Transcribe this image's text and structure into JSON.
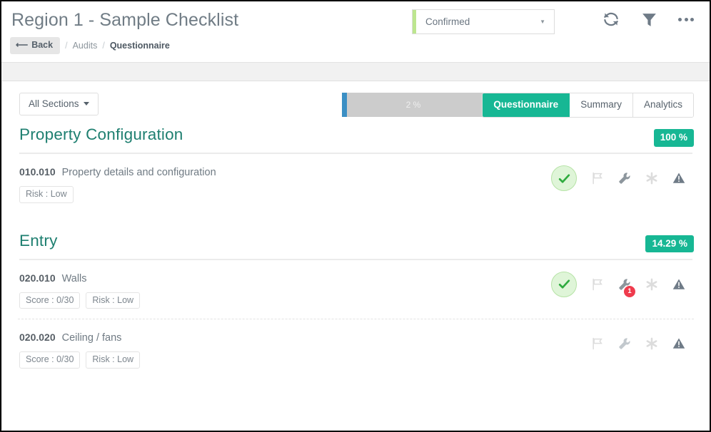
{
  "header": {
    "title": "Region 1 - Sample Checklist",
    "back_label": "Back",
    "back_icon": "arrow-left-icon",
    "breadcrumb": {
      "separator": "/",
      "parent": "Audits",
      "current": "Questionnaire"
    },
    "status": {
      "value": "Confirmed",
      "caret": "▼",
      "accent_color": "#bde68f"
    },
    "icons": [
      {
        "name": "refresh-icon"
      },
      {
        "name": "filter-icon"
      },
      {
        "name": "more-options-icon"
      }
    ]
  },
  "toolbar": {
    "sections_filter_label": "All Sections",
    "progress": {
      "percent_label": "2 %",
      "percent_value": 2,
      "fill_color": "#3b8fc4",
      "track_color": "#cccccc"
    },
    "tabs": [
      {
        "label": "Questionnaire",
        "active": true
      },
      {
        "label": "Summary",
        "active": false
      },
      {
        "label": "Analytics",
        "active": false
      }
    ]
  },
  "colors": {
    "accent_teal": "#17b794",
    "section_title": "#1e7f70",
    "badge_red": "#ef3b4d"
  },
  "sections": [
    {
      "title": "Property Configuration",
      "percent_badge": "100 %",
      "questions": [
        {
          "code": "010.010",
          "text": "Property details and configuration",
          "chips": [
            "Risk : Low"
          ],
          "answered": true,
          "icons": [
            {
              "name": "flag-icon",
              "state": "inactive",
              "badge": null
            },
            {
              "name": "wrench-icon",
              "state": "active",
              "badge": null
            },
            {
              "name": "asterisk-icon",
              "state": "inactive",
              "badge": null
            },
            {
              "name": "warning-triangle-icon",
              "state": "active",
              "badge": null
            }
          ]
        }
      ]
    },
    {
      "title": "Entry",
      "percent_badge": "14.29 %",
      "questions": [
        {
          "code": "020.010",
          "text": "Walls",
          "chips": [
            "Score : 0/30",
            "Risk : Low"
          ],
          "answered": true,
          "icons": [
            {
              "name": "flag-icon",
              "state": "inactive",
              "badge": null
            },
            {
              "name": "wrench-icon",
              "state": "active",
              "badge": "1"
            },
            {
              "name": "asterisk-icon",
              "state": "inactive",
              "badge": null
            },
            {
              "name": "warning-triangle-icon",
              "state": "active",
              "badge": null
            }
          ]
        },
        {
          "code": "020.020",
          "text": "Ceiling / fans",
          "chips": [
            "Score : 0/30",
            "Risk : Low"
          ],
          "answered": false,
          "icons": [
            {
              "name": "flag-icon",
              "state": "inactive",
              "badge": null
            },
            {
              "name": "wrench-icon",
              "state": "inactive",
              "badge": null
            },
            {
              "name": "asterisk-icon",
              "state": "inactive",
              "badge": null
            },
            {
              "name": "warning-triangle-icon",
              "state": "active",
              "badge": null
            }
          ]
        }
      ]
    }
  ]
}
